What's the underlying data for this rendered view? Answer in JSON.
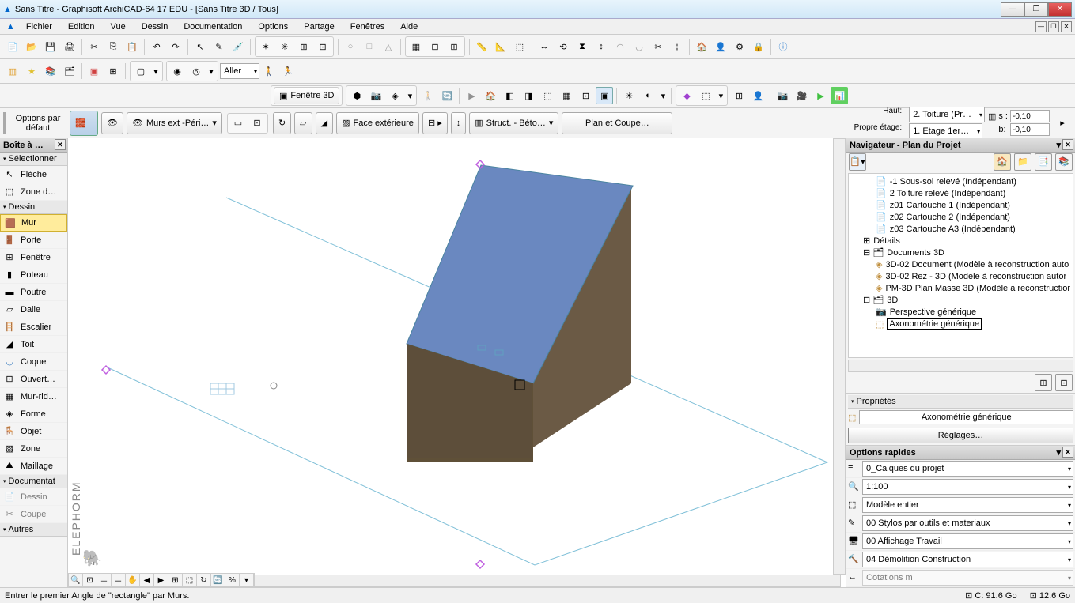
{
  "title": "Sans Titre - Graphisoft ArchiCAD-64 17 EDU - [Sans Titre 3D / Tous]",
  "menus": [
    "Fichier",
    "Edition",
    "Vue",
    "Dessin",
    "Documentation",
    "Options",
    "Partage",
    "Fenêtres",
    "Aide"
  ],
  "toolbar2": {
    "aller": "Aller"
  },
  "toolbar3": {
    "fenetre3d": "Fenêtre 3D"
  },
  "infobar": {
    "default_options": "Options par défaut",
    "layer": "Murs ext -Péri…",
    "surface": "Face extérieure",
    "struct": "Struct. - Béto…",
    "plan": "Plan et Coupe…",
    "haut_label": "Haut:",
    "etage_label": "Propre étage:",
    "haut_val": "2. Toiture (Pr…",
    "etage_val": "1. Etage 1er…",
    "s_label": "s :",
    "b_label": "b:",
    "s_val": "-0,10",
    "b_val": "-0,10"
  },
  "toolbox": {
    "title": "Boîte à …",
    "select_header": "Sélectionner",
    "arrow": "Flèche",
    "zone_sel": "Zone d…",
    "design_header": "Dessin",
    "tools": [
      "Mur",
      "Porte",
      "Fenêtre",
      "Poteau",
      "Poutre",
      "Dalle",
      "Escalier",
      "Toit",
      "Coque",
      "Ouvert…",
      "Mur-rid…",
      "Forme",
      "Objet",
      "Zone",
      "Maillage"
    ],
    "doc_header": "Documentat",
    "doc_tools": [
      "Dessin",
      "Coupe"
    ],
    "more": "Autres"
  },
  "navigator": {
    "title": "Navigateur - Plan du Projet",
    "items": [
      {
        "l": 1,
        "icon": "page",
        "t": "-1 Sous-sol relevé (Indépendant)"
      },
      {
        "l": 1,
        "icon": "page",
        "t": "2 Toiture relevé (Indépendant)"
      },
      {
        "l": 1,
        "icon": "page",
        "t": "z01 Cartouche 1 (Indépendant)"
      },
      {
        "l": 1,
        "icon": "page",
        "t": "z02 Cartouche 2 (Indépendant)"
      },
      {
        "l": 1,
        "icon": "page",
        "t": "z03 Cartouche A3 (Indépendant)"
      },
      {
        "l": 0,
        "icon": "folder",
        "t": "Détails"
      },
      {
        "l": 0,
        "icon": "folder3d",
        "t": "Documents 3D"
      },
      {
        "l": 1,
        "icon": "doc3d",
        "t": "3D-02 Document (Modèle à reconstruction auto"
      },
      {
        "l": 1,
        "icon": "doc3d",
        "t": "3D-02 Rez - 3D (Modèle à reconstruction autor"
      },
      {
        "l": 1,
        "icon": "doc3d",
        "t": "PM-3D Plan Masse 3D (Modèle à reconstructior"
      },
      {
        "l": 0,
        "icon": "folder3d",
        "t": "3D"
      },
      {
        "l": 1,
        "icon": "cam",
        "t": "Perspective générique"
      },
      {
        "l": 1,
        "icon": "cube",
        "t": "Axonométrie générique",
        "sel": true
      }
    ],
    "props_header": "Propriétés",
    "prop_val": "Axonométrie générique",
    "settings_btn": "Réglages…"
  },
  "quick": {
    "title": "Options rapides",
    "rows": [
      "0_Calques du projet",
      "1:100",
      "Modèle entier",
      "00 Stylos par outils et materiaux",
      "00 Affichage Travail",
      "04 Démolition Construction",
      "Cotations m"
    ]
  },
  "status": {
    "msg": "Entrer le premier Angle de \"rectangle\" par Murs.",
    "disk_c": "C: 91.6 Go",
    "disk_other": "12.6 Go"
  },
  "watermark": "ELEPHORM"
}
